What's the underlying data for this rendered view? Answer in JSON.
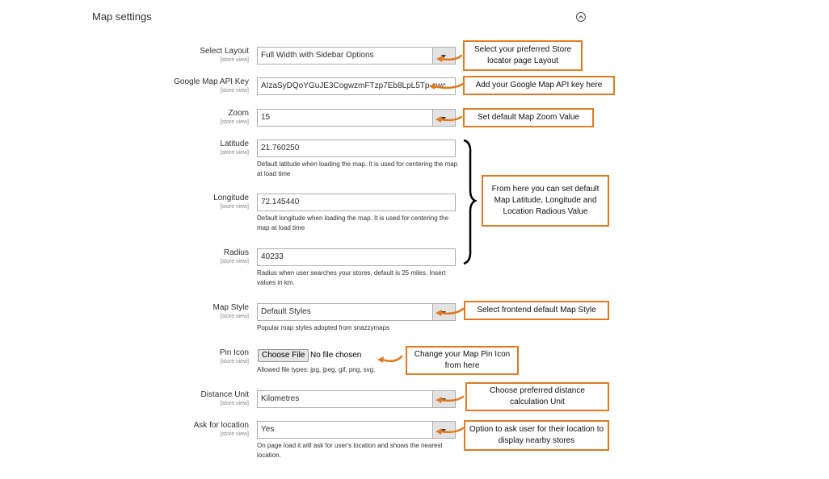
{
  "section": {
    "title": "Map settings"
  },
  "scope_label": "[store view]",
  "fields": {
    "layout": {
      "label": "Select Layout",
      "value": "Full Width with Sidebar Options"
    },
    "api_key": {
      "label": "Google Map API Key",
      "value": "AIzaSyDQoYGuJE3CogwzmFTzp7Eb8LpL5Tp-swc"
    },
    "zoom": {
      "label": "Zoom",
      "value": "15"
    },
    "latitude": {
      "label": "Latitude",
      "value": "21.760250",
      "note": "Default latitude when loading the map. It is used for centering the map at load time"
    },
    "longitude": {
      "label": "Longitude",
      "value": "72.145440",
      "note": "Default longitude when loading the map. It is used for centering the map at load time"
    },
    "radius": {
      "label": "Radius",
      "value": "40233",
      "note": "Radius when user searches your stores, default is 25 miles. Insert values in km."
    },
    "map_style": {
      "label": "Map Style",
      "value": "Default Styles",
      "note": "Popular map styles adopted from snazzymaps"
    },
    "pin_icon": {
      "label": "Pin Icon",
      "button": "Choose File",
      "status": "No file chosen",
      "note": "Allowed file types: jpg, jpeg, gif, png, svg."
    },
    "distance_unit": {
      "label": "Distance Unit",
      "value": "Kilometres"
    },
    "ask_location": {
      "label": "Ask for location",
      "value": "Yes",
      "note": "On page load it will ask for user's location and shows the nearest location."
    }
  },
  "callouts": {
    "layout": "Select your preferred Store locator page Layout",
    "api_key": "Add your Google Map API key here",
    "zoom": "Set default Map Zoom Value",
    "coords": "From here you can set default Map Latitude, Longitude and Location Radious Value",
    "map_style": "Select frontend default Map Style",
    "pin_icon": "Change your Map Pin Icon from here",
    "distance_unit": "Choose preferred distance calculation Unit",
    "ask_location": "Option to ask user for their location to display nearby stores"
  },
  "colors": {
    "accent": "#e07b21",
    "text": "#303030",
    "border": "#adadad"
  }
}
